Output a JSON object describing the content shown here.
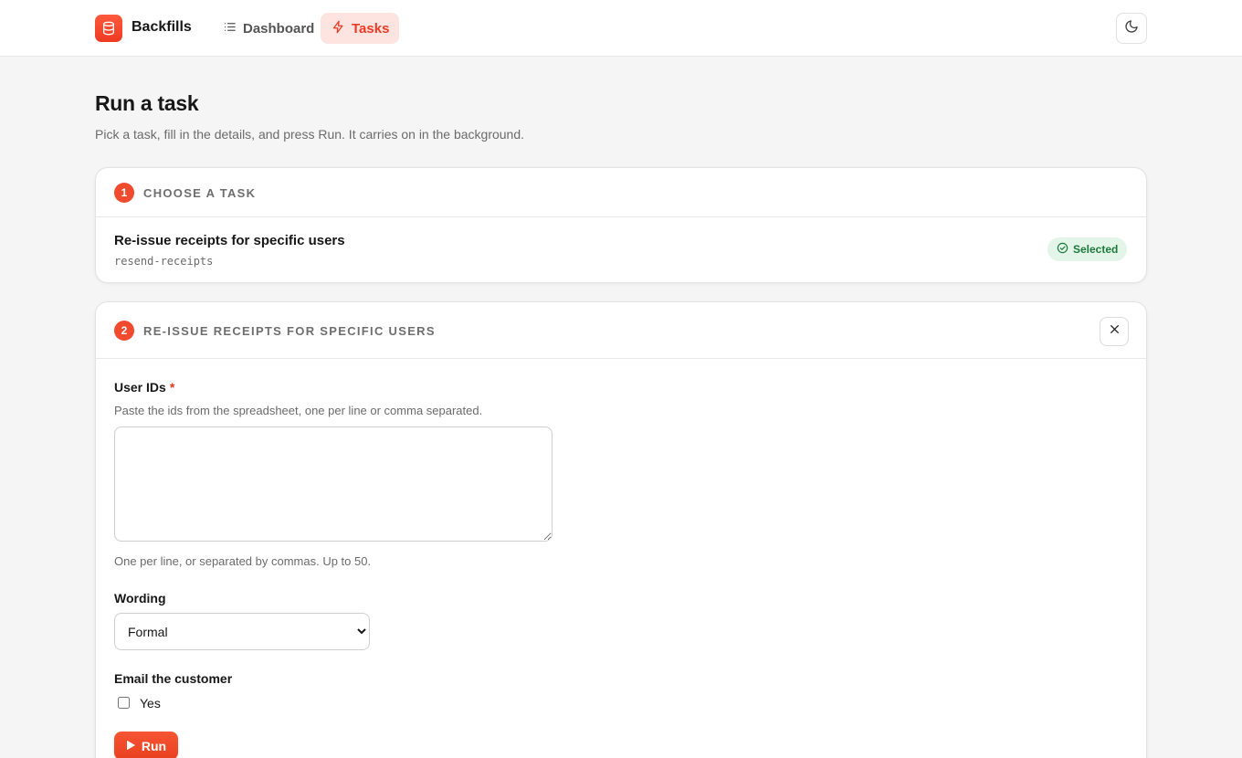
{
  "brand": {
    "name": "Backfills"
  },
  "nav": {
    "items": [
      {
        "label": "Dashboard",
        "icon": "list-icon",
        "active": false
      },
      {
        "label": "Tasks",
        "icon": "bolt-icon",
        "active": true
      }
    ]
  },
  "header": {
    "theme_toggle_icon": "moon-icon"
  },
  "page": {
    "title": "Run a task",
    "subtitle": "Pick a task, fill in the details, and press Run. It carries on in the background."
  },
  "step1": {
    "number": "1",
    "title": "Choose a task",
    "task_name": "Re-issue receipts for specific users",
    "task_slug": "resend-receipts",
    "status": "Selected"
  },
  "step2": {
    "number": "2",
    "title": "Re-issue receipts for specific users",
    "user_ids": {
      "label": "User IDs",
      "required_mark": "*",
      "description": "Paste the ids from the spreadsheet, one per line or comma separated.",
      "value": "",
      "help": "One per line, or separated by commas. Up to 50."
    },
    "wording": {
      "label": "Wording",
      "selected": "Formal"
    },
    "email": {
      "label": "Email the customer",
      "option_label": "Yes",
      "checked": false
    },
    "run_label": "Run"
  },
  "colors": {
    "accent": "#f04a2f",
    "accent_soft": "#fde4e0",
    "success_bg": "#e3f4e9",
    "success_text": "#1c7a3d"
  }
}
